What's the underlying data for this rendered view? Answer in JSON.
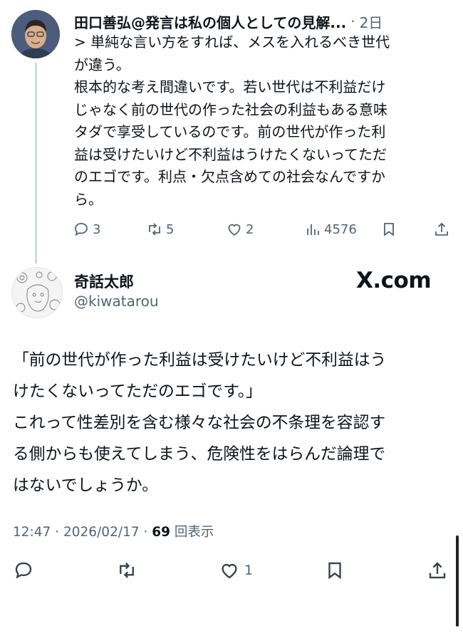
{
  "parent": {
    "author_name": "田口善弘@発言は私の個人としての見解...",
    "separator": "·",
    "time": "2日",
    "text": "> 単純な言い方をすれば、メスを入れるべき世代\nが違う。\n根本的な考え間違いです。若い世代は不利益だけ\nじゃなく前の世代の作った社会の利益もある意味\nタダで享受しているのです。前の世代が作った利\n益は受けたいけど不利益はうけたくないってただ\nのエゴです。利点・欠点含めての社会なんですか\nら。",
    "actions": {
      "replies": "3",
      "reposts": "5",
      "likes": "2",
      "views": "4576"
    }
  },
  "reply": {
    "author_name": "奇話太郎",
    "handle": "@kiwatarou",
    "watermark": "X.com",
    "text": "「前の世代が作った利益は受けたいけど不利益はう\nけたくないってただのエゴです。」\nこれって性差別を含む様々な社会の不条理を容認す\nる側からも使えてしまう、危険性をはらんだ論理で\nはないでしょうか。",
    "time": "12:47",
    "date": "2026/02/17",
    "views_count": "69",
    "views_label": "回表示",
    "actions": {
      "likes": "1"
    }
  },
  "icons": {
    "reply": "reply-bubble-icon",
    "repost": "repost-icon",
    "like": "heart-icon",
    "views": "views-bar-icon",
    "bookmark": "bookmark-icon",
    "share": "share-icon"
  },
  "colors": {
    "text": "#0f1419",
    "secondary": "#536471",
    "divider": "#cfd9de"
  }
}
